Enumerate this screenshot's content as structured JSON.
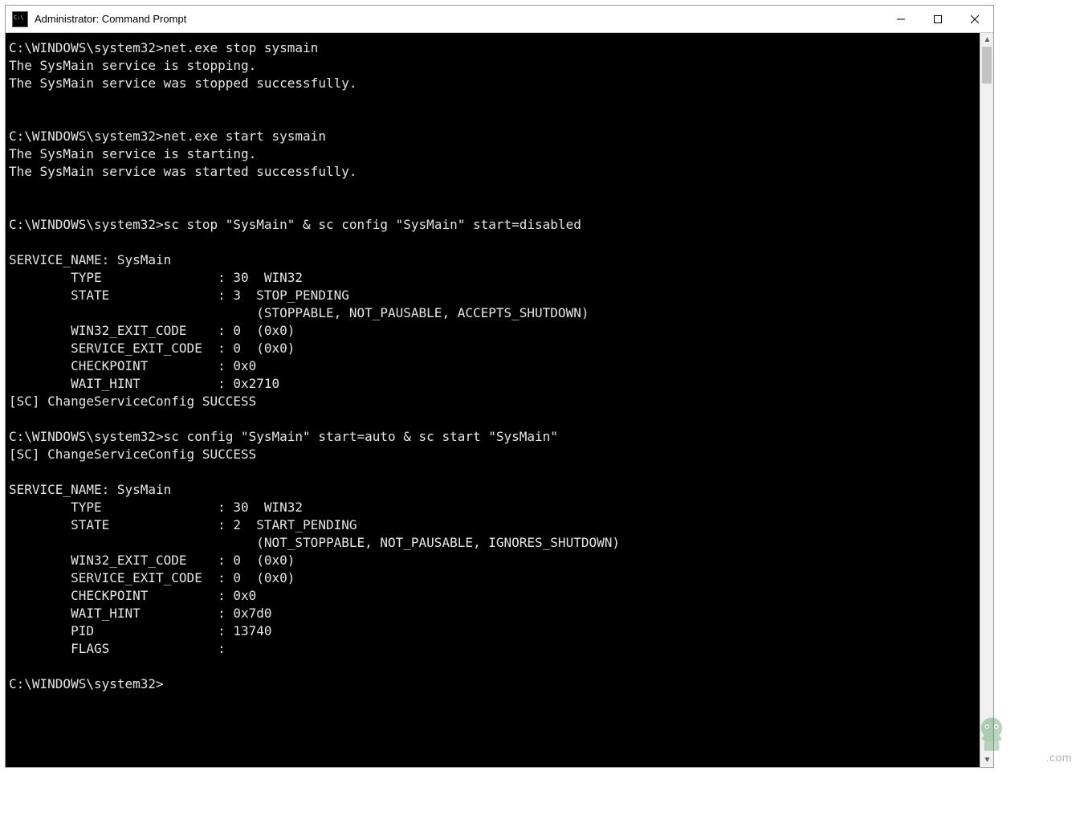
{
  "window": {
    "title": "Administrator: Command Prompt"
  },
  "terminal": {
    "lines": [
      "C:\\WINDOWS\\system32>net.exe stop sysmain",
      "The SysMain service is stopping.",
      "The SysMain service was stopped successfully.",
      "",
      "",
      "C:\\WINDOWS\\system32>net.exe start sysmain",
      "The SysMain service is starting.",
      "The SysMain service was started successfully.",
      "",
      "",
      "C:\\WINDOWS\\system32>sc stop \"SysMain\" & sc config \"SysMain\" start=disabled",
      "",
      "SERVICE_NAME: SysMain",
      "        TYPE               : 30  WIN32",
      "        STATE              : 3  STOP_PENDING",
      "                                (STOPPABLE, NOT_PAUSABLE, ACCEPTS_SHUTDOWN)",
      "        WIN32_EXIT_CODE    : 0  (0x0)",
      "        SERVICE_EXIT_CODE  : 0  (0x0)",
      "        CHECKPOINT         : 0x0",
      "        WAIT_HINT          : 0x2710",
      "[SC] ChangeServiceConfig SUCCESS",
      "",
      "C:\\WINDOWS\\system32>sc config \"SysMain\" start=auto & sc start \"SysMain\"",
      "[SC] ChangeServiceConfig SUCCESS",
      "",
      "SERVICE_NAME: SysMain",
      "        TYPE               : 30  WIN32",
      "        STATE              : 2  START_PENDING",
      "                                (NOT_STOPPABLE, NOT_PAUSABLE, IGNORES_SHUTDOWN)",
      "        WIN32_EXIT_CODE    : 0  (0x0)",
      "        SERVICE_EXIT_CODE  : 0  (0x0)",
      "        CHECKPOINT         : 0x0",
      "        WAIT_HINT          : 0x7d0",
      "        PID                : 13740",
      "        FLAGS              :",
      "",
      "C:\\WINDOWS\\system32>"
    ]
  },
  "watermark": {
    "suffix": ".com"
  }
}
